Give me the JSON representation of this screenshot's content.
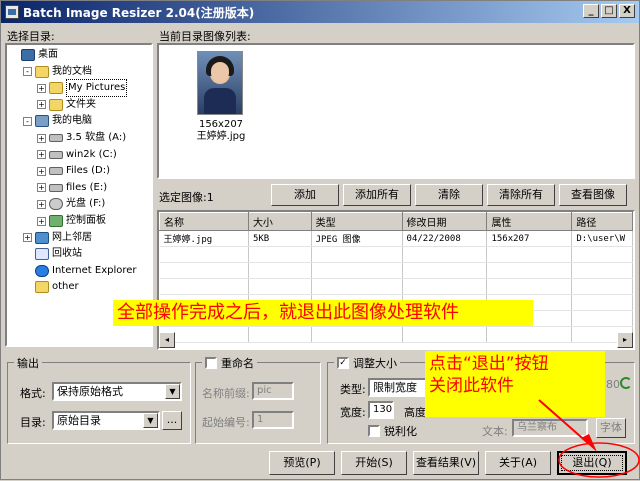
{
  "window": {
    "title": "Batch Image Resizer 2.04(注册版本)",
    "min_label": "_",
    "max_label": "□",
    "close_label": "X"
  },
  "left": {
    "label": "选择目录:",
    "tree": [
      {
        "label": "桌面",
        "icon": "desktop-icon",
        "level": 0,
        "expander": ""
      },
      {
        "label": "我的文档",
        "icon": "folder-icon",
        "level": 1,
        "expander": "-"
      },
      {
        "label": "My Pictures",
        "icon": "folder-icon",
        "level": 2,
        "expander": "+"
      },
      {
        "label": "文件夹",
        "icon": "folder-icon",
        "level": 2,
        "expander": "+"
      },
      {
        "label": "我的电脑",
        "icon": "computer-icon",
        "level": 1,
        "expander": "-"
      },
      {
        "label": "3.5 软盘 (A:)",
        "icon": "floppy-icon",
        "level": 2,
        "expander": "+"
      },
      {
        "label": "win2k (C:)",
        "icon": "drive-icon",
        "level": 2,
        "expander": "+"
      },
      {
        "label": "Files (D:)",
        "icon": "drive-icon",
        "level": 2,
        "expander": "+"
      },
      {
        "label": "files (E:)",
        "icon": "drive-icon",
        "level": 2,
        "expander": "+"
      },
      {
        "label": "光盘 (F:)",
        "icon": "cd-drive-icon",
        "level": 2,
        "expander": "+"
      },
      {
        "label": "控制面板",
        "icon": "control-panel-icon",
        "level": 2,
        "expander": "+"
      },
      {
        "label": "网上邻居",
        "icon": "network-icon",
        "level": 1,
        "expander": "+"
      },
      {
        "label": "回收站",
        "icon": "recycle-bin-icon",
        "level": 1,
        "expander": ""
      },
      {
        "label": "Internet Explorer",
        "icon": "ie-icon",
        "level": 1,
        "expander": ""
      },
      {
        "label": "other",
        "icon": "folder-icon",
        "level": 1,
        "expander": ""
      }
    ]
  },
  "preview": {
    "label": "当前目录图像列表:",
    "thumb_size": "156x207",
    "thumb_name": "王婷婷.jpg"
  },
  "toolbar": {
    "selected_label": "选定图像:1",
    "add": "添加",
    "add_all": "添加所有",
    "clear": "清除",
    "clear_all": "清除所有",
    "view": "查看图像"
  },
  "file_table": {
    "columns": [
      "名称",
      "大小",
      "类型",
      "修改日期",
      "属性",
      "路径"
    ],
    "rows": [
      [
        "王婷婷.jpg",
        "5KB",
        "JPEG 图像",
        "04/22/2008",
        "156x207",
        "D:\\user\\W"
      ]
    ]
  },
  "output": {
    "title": "输出",
    "format_label": "格式:",
    "format_value": "保持原始格式",
    "dir_label": "目录:",
    "dir_value": "原始目录",
    "browse": "..."
  },
  "rename": {
    "title": "重命名",
    "prefix_label": "名称前缀:",
    "prefix_value": "pic",
    "start_label": "起始编号:",
    "start_value": "1"
  },
  "resize": {
    "title": "调整大小",
    "checked": "✓",
    "type_label": "类型:",
    "type_value": "限制宽度",
    "width_label": "宽度:",
    "width_value": "130",
    "height_label": "高度",
    "sharpen_label": "锐利化",
    "percent_fragment": "80",
    "text_label": "文本:",
    "text_value": "乌兰察布",
    "font_btn": "字体"
  },
  "bottom": {
    "preview": "预览(P)",
    "start": "开始(S)",
    "results": "查看结果(V)",
    "about": "关于(A)",
    "exit": "退出(Q)"
  },
  "annotations": {
    "main": "全部操作完成之后，就退出此图像处理软件",
    "hint_line1": "点击“退出”按钮",
    "hint_line2": "关闭此软件",
    "colors": {
      "box": "#ffff00",
      "text": "#ff0000"
    }
  }
}
